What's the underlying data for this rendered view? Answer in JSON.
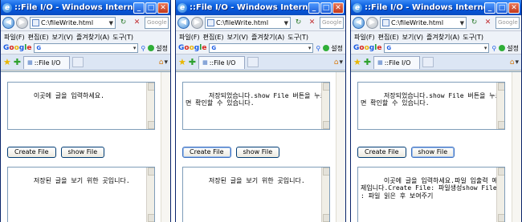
{
  "windows": [
    {
      "title": "::File I/O - Windows Internet Exp...",
      "address": "C:\\fileWrite.html",
      "search_placeholder": "Google",
      "menu": [
        "파일(F)",
        "편집(E)",
        "보기(V)",
        "즐겨찾기(A)",
        "도구(T)"
      ],
      "google_label": "Google",
      "google_search_value": "G",
      "settings_label": "설정",
      "tab_title": "::File I/O",
      "input_text": "이곳에 글을 입력하세요.",
      "create_label": "Create File",
      "show_label": "show File",
      "output_text": "저장된 글을 보기 위한 곳입니다."
    },
    {
      "title": "::File I/O - Windows Internet Exp...",
      "address": "C:\\fileWrite.html",
      "search_placeholder": "Google",
      "menu": [
        "파일(F)",
        "편집(E)",
        "보기(V)",
        "즐겨찾기(A)",
        "도구(T)"
      ],
      "google_label": "Google",
      "google_search_value": "G",
      "settings_label": "설정",
      "tab_title": "::File I/O",
      "input_text": "저장되었습니다.show File 버튼을 누르면 확인할 수 있습니다.",
      "create_label": "Create File",
      "show_label": "show File",
      "output_text": "저장된 글을 보기 위한 곳입니다."
    },
    {
      "title": "::File I/O - Windows Internet Exp...",
      "address": "C:\\fileWrite.html",
      "search_placeholder": "Google",
      "menu": [
        "파일(F)",
        "편집(E)",
        "보기(V)",
        "즐겨찾기(A)",
        "도구(T)"
      ],
      "google_label": "Google",
      "google_search_value": "G",
      "settings_label": "설정",
      "tab_title": "::File I/O",
      "input_text": "저장되었습니다.show File 버튼을 누르면 확인할 수 있습니다.",
      "create_label": "Create File",
      "show_label": "show File",
      "output_text": "이곳에 글을 입력하세요.파일 입출력 예제입니다.Create File: 파일생성show File : 파일 읽은 후 보여주기"
    }
  ],
  "icons": {
    "back": "back-arrow-icon",
    "forward": "forward-arrow-icon",
    "refresh": "refresh-icon",
    "stop": "stop-icon",
    "favorites": "favorites-star-icon",
    "add_favorite": "add-favorite-icon",
    "home": "home-icon"
  },
  "colors": {
    "titlebar": "#0553d6",
    "close_button": "#c2381a",
    "button_border": "#003c74"
  }
}
